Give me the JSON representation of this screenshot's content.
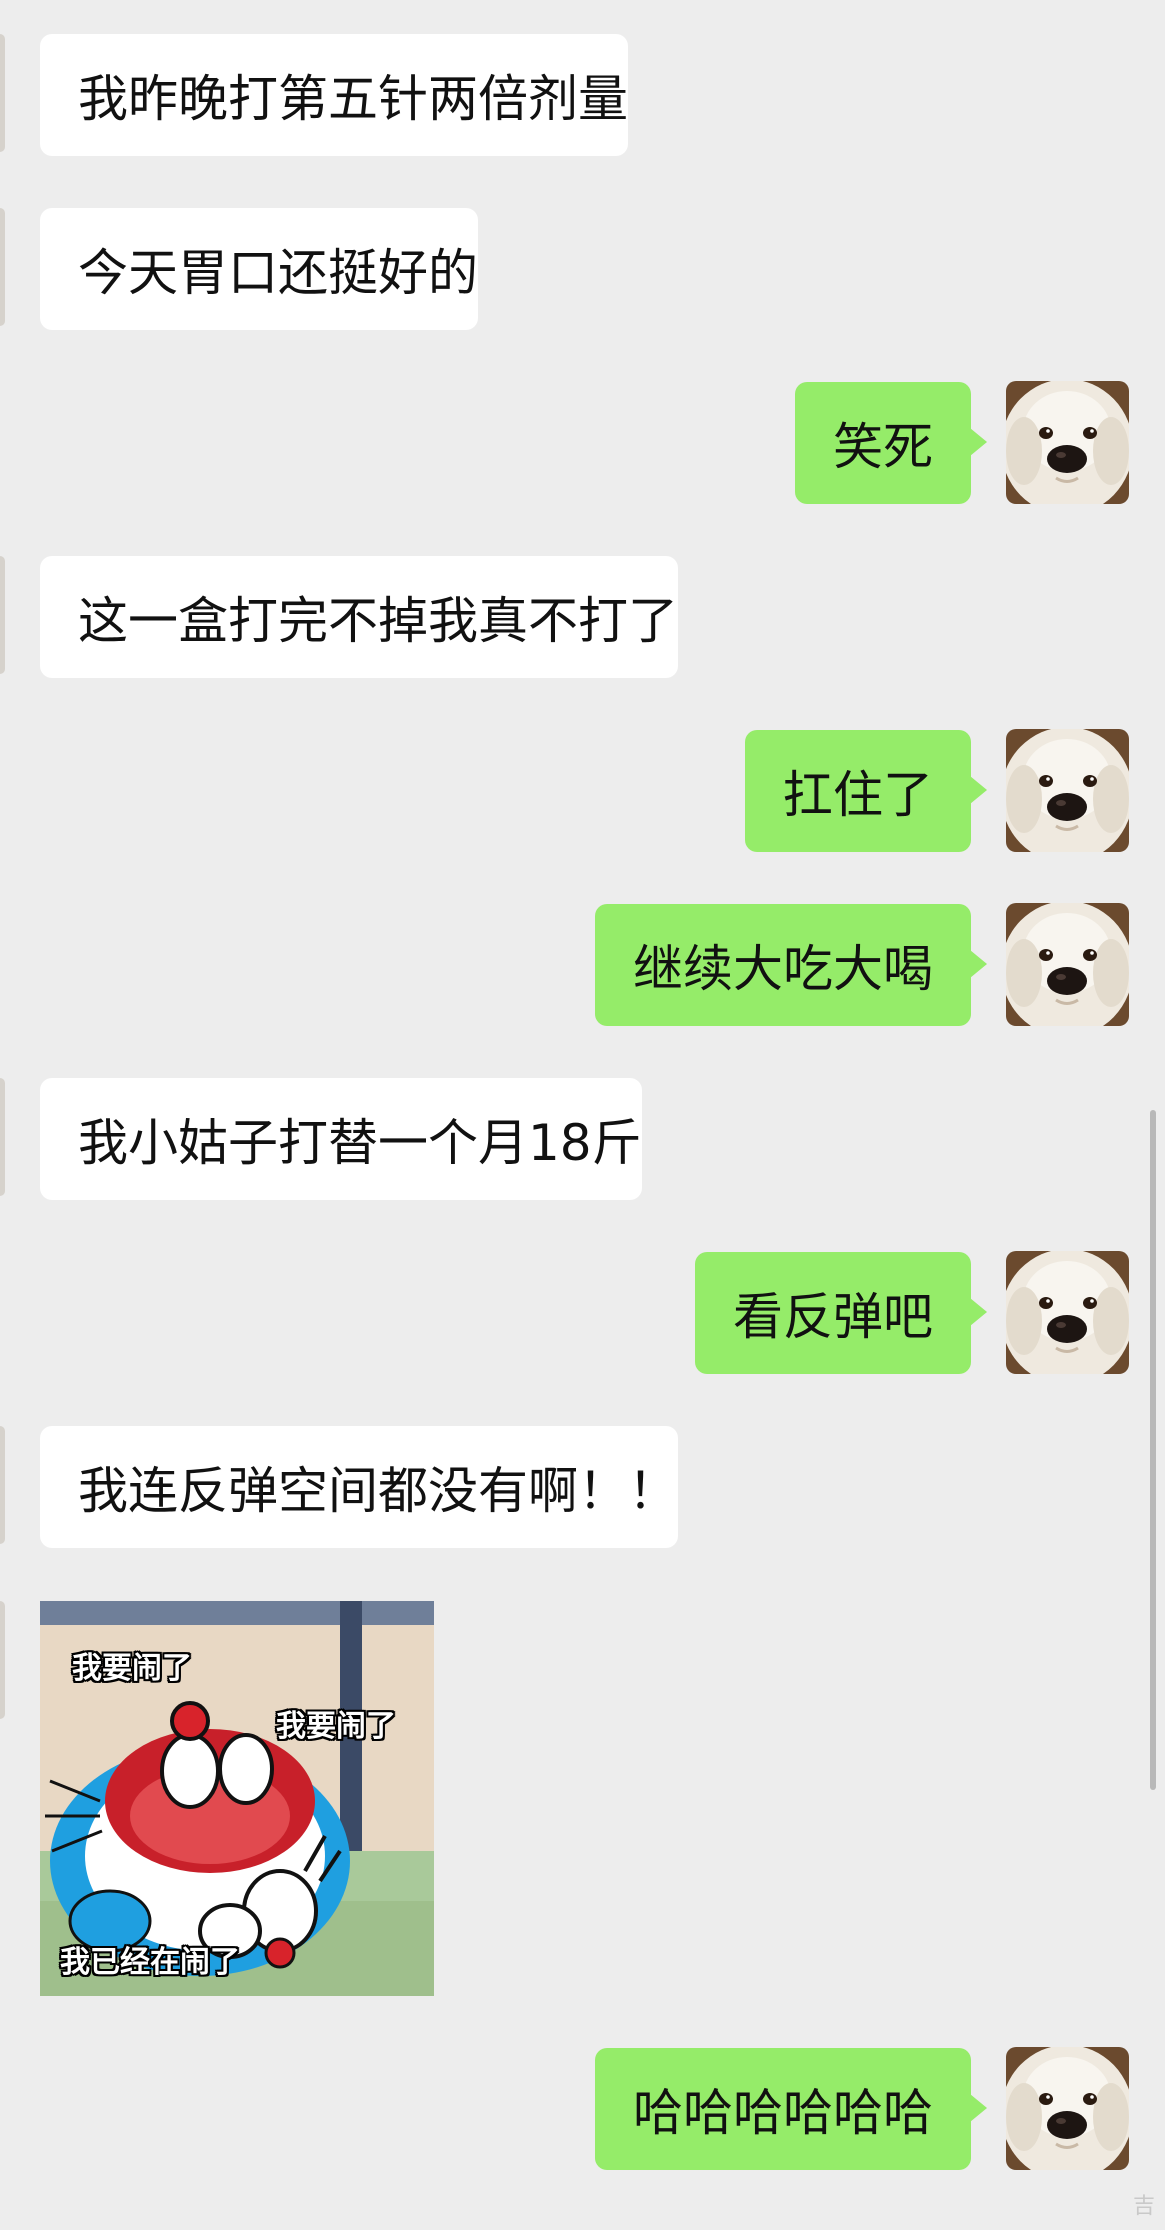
{
  "conversation": {
    "messages": [
      {
        "side": "incoming",
        "text": "我昨晚打第五针两倍剂量"
      },
      {
        "side": "incoming",
        "text": "今天胃口还挺好的"
      },
      {
        "side": "outgoing",
        "text": "笑死"
      },
      {
        "side": "incoming",
        "text": "这一盒打完不掉我真不打了"
      },
      {
        "side": "outgoing",
        "text": "扛住了"
      },
      {
        "side": "outgoing",
        "text": "继续大吃大喝"
      },
      {
        "side": "incoming",
        "text": "我小姑子打替一个月18斤"
      },
      {
        "side": "outgoing",
        "text": "看反弹吧"
      },
      {
        "side": "incoming",
        "text": "我连反弹空间都没有啊！！"
      },
      {
        "side": "outgoing",
        "text": "哈哈哈哈哈哈"
      }
    ],
    "sticker": {
      "side": "incoming",
      "caption_top": "我要闹了",
      "caption_mid": "我要闹了",
      "caption_bottom": "我已经在闹了"
    }
  },
  "avatar": {
    "icon": "white-dog-avatar-icon"
  },
  "watermark": {
    "text": "吉"
  },
  "colors": {
    "background": "#ededed",
    "incoming_bubble": "#ffffff",
    "outgoing_bubble": "#95ec69",
    "text": "#111111"
  }
}
